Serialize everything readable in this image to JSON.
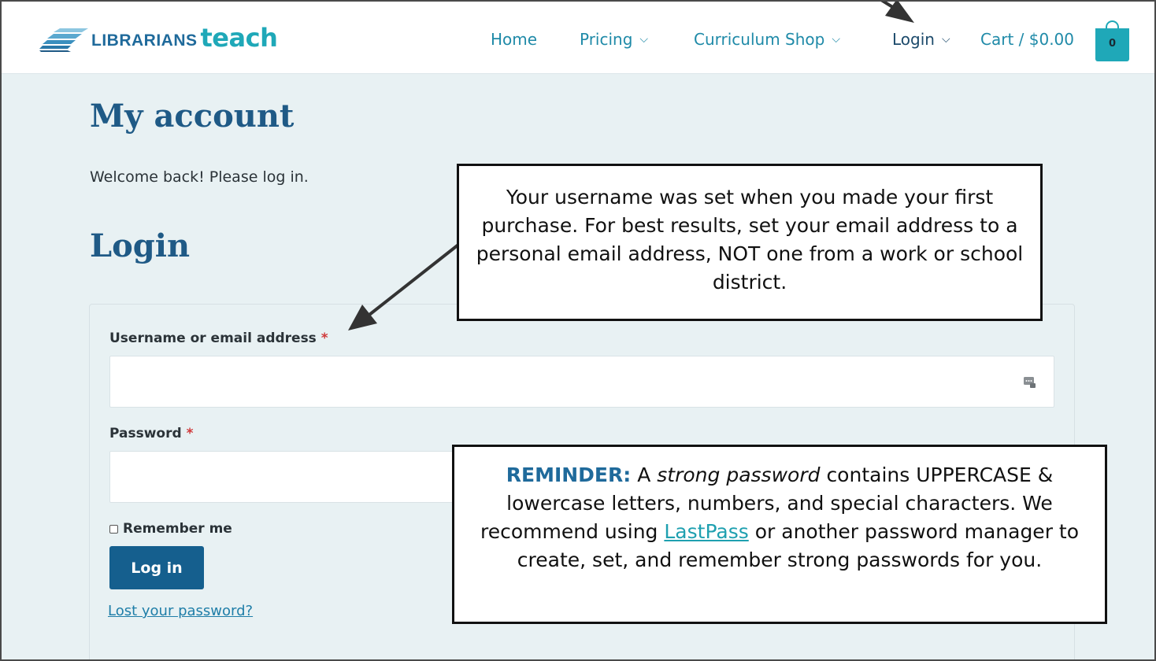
{
  "header": {
    "logo_word1": "LIBRARIANS",
    "logo_word2": "teach",
    "nav": [
      {
        "label": "Home"
      },
      {
        "label": "Pricing",
        "chevron": "⌵"
      },
      {
        "label": "Curriculum Shop",
        "chevron": "⌵"
      },
      {
        "label": "Login",
        "chevron": "⌵"
      },
      {
        "label": "Cart / $0.00"
      }
    ],
    "cart_count": "0"
  },
  "page": {
    "title": "My account",
    "welcome": "Welcome back! Please log in.",
    "login_heading": "Login"
  },
  "form": {
    "username_label": "Username or email address",
    "password_label": "Password",
    "required_mark": "*",
    "username_value": "",
    "password_value": "",
    "remember_label": "Remember me",
    "remember_checked": false,
    "submit_label": "Log in",
    "lost_password": "Lost your password?"
  },
  "callouts": {
    "username_note": "Your username was set when you made your first purchase. For best results, set your email address to a personal email address, NOT one from a work or school district.",
    "reminder_label": "REMINDER:",
    "reminder_a": "A",
    "reminder_em": "strong password",
    "reminder_mid": "contains UPPERCASE & lowercase letters, numbers, and special characters. We recommend using",
    "reminder_link": "LastPass",
    "reminder_end": "or another password manager to create, set, and remember strong passwords for you."
  },
  "icons": {
    "cart": "shopping-bag-icon",
    "password_manager": "key-icon",
    "logo": "books-icon"
  },
  "colors": {
    "brand_dark": "#1f5a86",
    "brand_teal": "#1fa8b8",
    "button": "#155f8e",
    "page_bg": "#e8f1f3",
    "required": "#d0393a"
  }
}
